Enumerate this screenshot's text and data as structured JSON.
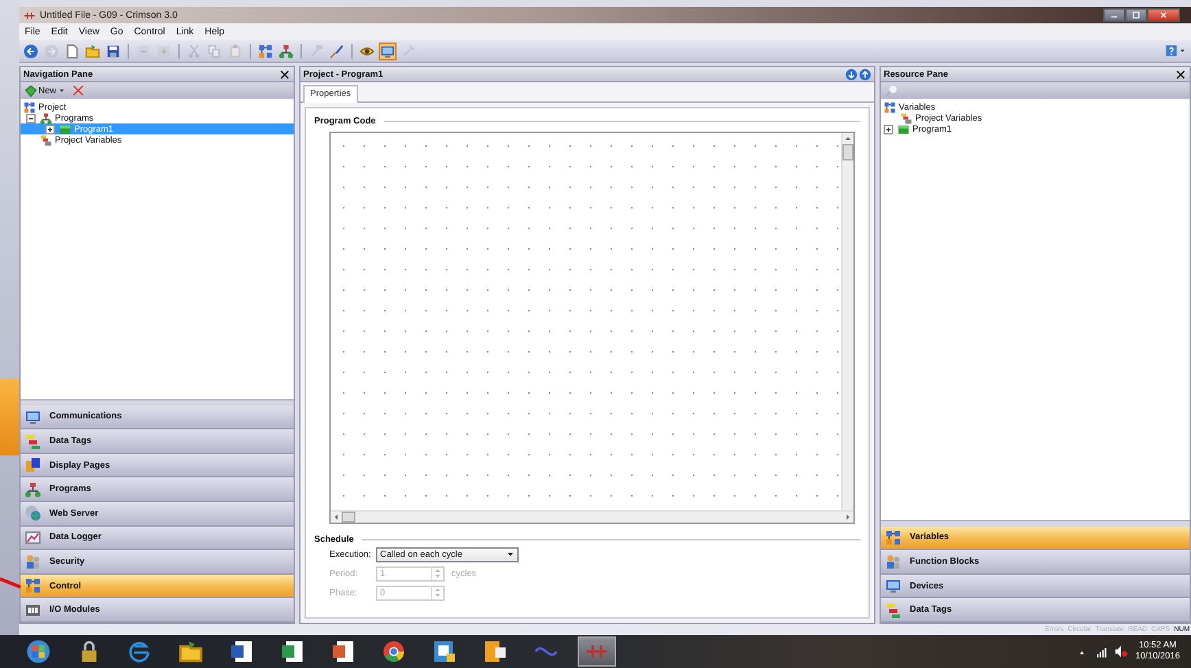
{
  "window": {
    "title": "Untitled File - G09 - Crimson 3.0"
  },
  "menu": [
    "File",
    "Edit",
    "View",
    "Go",
    "Control",
    "Link",
    "Help"
  ],
  "toolbar": [
    {
      "disabled": false,
      "selected": false
    },
    {
      "disabled": true,
      "selected": false
    },
    {
      "disabled": false,
      "selected": false
    },
    {
      "disabled": false,
      "selected": false
    },
    {
      "disabled": false,
      "selected": false
    },
    {
      "disabled": true,
      "selected": false
    },
    {
      "disabled": true,
      "selected": false
    },
    {
      "disabled": true,
      "selected": false
    },
    {
      "disabled": true,
      "selected": false
    },
    {
      "disabled": true,
      "selected": false
    },
    {
      "disabled": false,
      "selected": false
    },
    {
      "disabled": false,
      "selected": false
    },
    {
      "disabled": true,
      "selected": false
    },
    {
      "disabled": false,
      "selected": false
    },
    {
      "disabled": false,
      "selected": false
    },
    {
      "disabled": false,
      "selected": true
    },
    {
      "disabled": true,
      "selected": false
    }
  ],
  "navigation_pane": {
    "title": "Navigation Pane",
    "new_button": "New",
    "tree": [
      {
        "label": "Project",
        "selected": false,
        "children": [
          {
            "label": "Programs",
            "selected": false,
            "expanded": true,
            "children": [
              {
                "label": "Program1",
                "selected": true,
                "expanded": false
              }
            ]
          },
          {
            "label": "Project Variables",
            "selected": false
          }
        ]
      }
    ],
    "categories": [
      {
        "label": "Communications",
        "selected": false
      },
      {
        "label": "Data Tags",
        "selected": false
      },
      {
        "label": "Display Pages",
        "selected": false
      },
      {
        "label": "Programs",
        "selected": false
      },
      {
        "label": "Web Server",
        "selected": false
      },
      {
        "label": "Data Logger",
        "selected": false
      },
      {
        "label": "Security",
        "selected": false
      },
      {
        "label": "Control",
        "selected": true
      },
      {
        "label": "I/O Modules",
        "selected": false
      }
    ]
  },
  "editor": {
    "title": "Project - Program1",
    "tabs": [
      {
        "label": "Properties",
        "selected": true
      }
    ],
    "program_code": {
      "heading": "Program Code"
    },
    "schedule": {
      "heading": "Schedule",
      "fields": [
        {
          "kind": "dropdown",
          "label": "Execution:",
          "value": "Called on each cycle",
          "disabled": false
        },
        {
          "kind": "spin",
          "label": "Period:",
          "value": "1",
          "unit": "cycles",
          "disabled": true
        },
        {
          "kind": "spin",
          "label": "Phase:",
          "value": "0",
          "disabled": true
        }
      ]
    }
  },
  "resource_pane": {
    "title": "Resource Pane",
    "tree": [
      {
        "label": "Variables",
        "selected": false,
        "children": [
          {
            "label": "Project Variables",
            "selected": false
          }
        ]
      },
      {
        "label": "Program1",
        "selected": false,
        "expanded": false
      }
    ],
    "categories": [
      {
        "label": "Variables",
        "selected": true
      },
      {
        "label": "Function Blocks",
        "selected": false
      },
      {
        "label": "Devices",
        "selected": false
      },
      {
        "label": "Data Tags",
        "selected": false
      }
    ]
  },
  "status_bar": [
    {
      "label": "Errors",
      "disabled": true
    },
    {
      "label": "Circular",
      "disabled": true
    },
    {
      "label": "Translate",
      "disabled": true
    },
    {
      "label": "READ",
      "disabled": true
    },
    {
      "label": "CAPS",
      "disabled": true
    },
    {
      "label": "NUM",
      "disabled": false
    }
  ],
  "taskbar": {
    "apps": [
      {
        "selected": false
      },
      {
        "selected": false
      },
      {
        "selected": false
      },
      {
        "selected": false
      },
      {
        "selected": false
      },
      {
        "selected": false
      },
      {
        "selected": false
      },
      {
        "selected": false
      },
      {
        "selected": false
      },
      {
        "selected": false
      },
      {
        "selected": false
      },
      {
        "selected": true
      }
    ],
    "clock": {
      "time": "10:52 AM",
      "date": "10/10/2016"
    }
  }
}
